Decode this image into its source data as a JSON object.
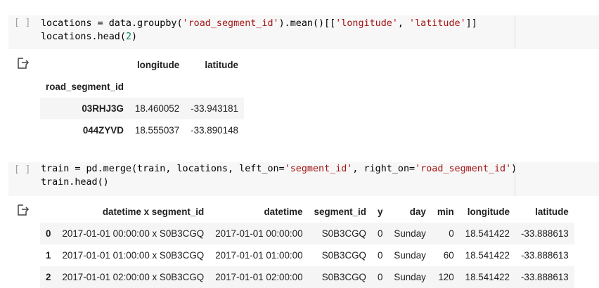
{
  "cell1": {
    "gutter": "[ ]",
    "code": [
      [
        {
          "t": "locations = data.groupby(",
          "c": ""
        },
        {
          "t": "'road_segment_id'",
          "c": "str"
        },
        {
          "t": ").mean()[[",
          "c": ""
        },
        {
          "t": "'longitude'",
          "c": "str"
        },
        {
          "t": ", ",
          "c": ""
        },
        {
          "t": "'latitude'",
          "c": "str"
        },
        {
          "t": "]]",
          "c": ""
        }
      ],
      [
        {
          "t": "locations.head(",
          "c": ""
        },
        {
          "t": "2",
          "c": "num"
        },
        {
          "t": ")",
          "c": ""
        }
      ]
    ]
  },
  "output1": {
    "columns": [
      "longitude",
      "latitude"
    ],
    "index_name": "road_segment_id",
    "rows": [
      {
        "index": "03RHJ3G",
        "values": [
          "18.460052",
          "-33.943181"
        ]
      },
      {
        "index": "044ZYVD",
        "values": [
          "18.555037",
          "-33.890148"
        ]
      }
    ]
  },
  "cell2": {
    "gutter": "[ ]",
    "code": [
      [
        {
          "t": "train = pd.merge(train, locations, left_on=",
          "c": ""
        },
        {
          "t": "'segment_id'",
          "c": "str"
        },
        {
          "t": ", right_on=",
          "c": ""
        },
        {
          "t": "'road_segment_id'",
          "c": "str"
        },
        {
          "t": ")",
          "c": ""
        }
      ],
      [
        {
          "t": "train.head()",
          "c": ""
        }
      ]
    ]
  },
  "output2": {
    "columns": [
      "datetime x segment_id",
      "datetime",
      "segment_id",
      "y",
      "day",
      "min",
      "longitude",
      "latitude"
    ],
    "rows": [
      {
        "index": "0",
        "values": [
          "2017-01-01 00:00:00 x S0B3CGQ",
          "2017-01-01 00:00:00",
          "S0B3CGQ",
          "0",
          "Sunday",
          "0",
          "18.541422",
          "-33.888613"
        ]
      },
      {
        "index": "1",
        "values": [
          "2017-01-01 01:00:00 x S0B3CGQ",
          "2017-01-01 01:00:00",
          "S0B3CGQ",
          "0",
          "Sunday",
          "60",
          "18.541422",
          "-33.888613"
        ]
      },
      {
        "index": "2",
        "values": [
          "2017-01-01 02:00:00 x S0B3CGQ",
          "2017-01-01 02:00:00",
          "S0B3CGQ",
          "0",
          "Sunday",
          "120",
          "18.541422",
          "-33.888613"
        ]
      }
    ]
  }
}
